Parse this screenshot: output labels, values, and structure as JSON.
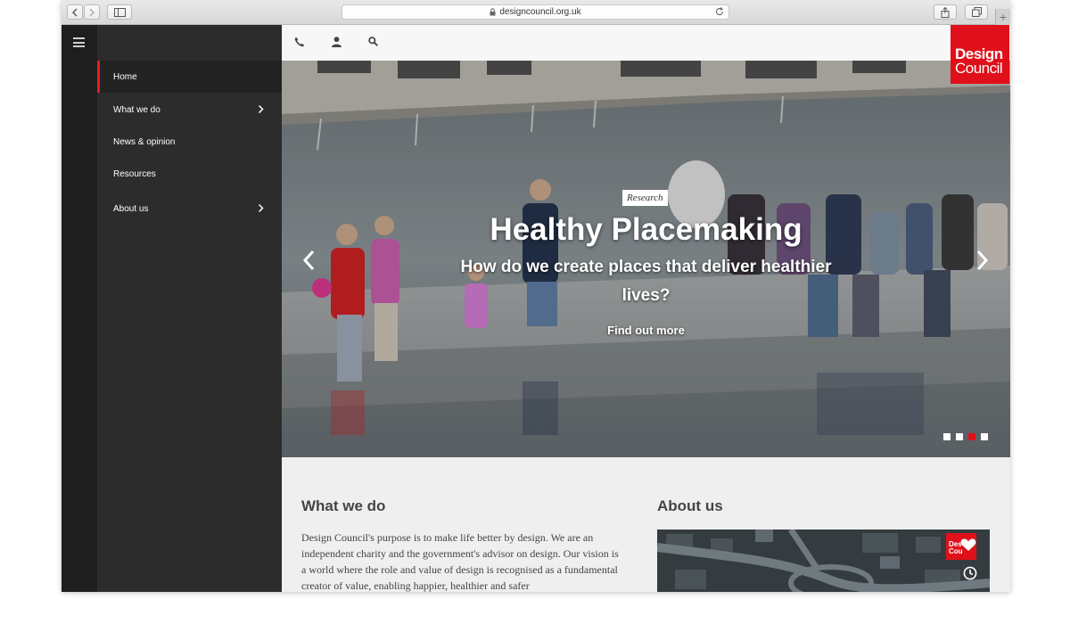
{
  "browser": {
    "url": "designcouncil.org.uk"
  },
  "menu": {
    "items": [
      {
        "label": "Home",
        "has_submenu": false,
        "active": true
      },
      {
        "label": "What we do",
        "has_submenu": true,
        "active": false
      },
      {
        "label": "News & opinion",
        "has_submenu": false,
        "active": false
      },
      {
        "label": "Resources",
        "has_submenu": false,
        "active": false
      },
      {
        "label": "About us",
        "has_submenu": true,
        "active": false
      }
    ]
  },
  "topbar": {
    "icons": [
      "phone-icon",
      "user-icon",
      "search-icon"
    ]
  },
  "logo": {
    "line1": "Design",
    "line2": "Council",
    "color": "#e0101a"
  },
  "hero": {
    "tag": "Research",
    "title": "Healthy Placemaking",
    "subtitle": "How do we create places that deliver healthier lives?",
    "cta": "Find out more",
    "slides_total": 4,
    "active_slide": 3
  },
  "sections": {
    "what_we_do": {
      "heading": "What we do",
      "text": "Design Council's purpose is to make life better by design. We are an independent charity and the government's advisor on design. Our vision is a world where the role and value of design is recognised as a fundamental creator of value, enabling happier, healthier and safer"
    },
    "about_us": {
      "heading": "About us",
      "image_logo_line1": "Des",
      "image_logo_line2": "Cou"
    }
  },
  "colors": {
    "accent": "#e0101a",
    "sidebar": "#2c2c2c",
    "rail": "#1e1e1e"
  }
}
